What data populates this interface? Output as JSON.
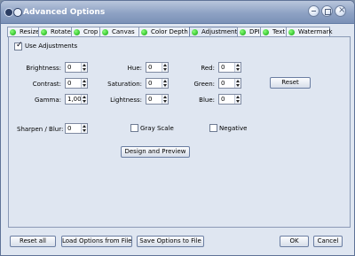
{
  "window": {
    "title": "Advanced Options"
  },
  "tabs": [
    {
      "label": "Resize"
    },
    {
      "label": "Rotate"
    },
    {
      "label": "Crop"
    },
    {
      "label": "Canvas"
    },
    {
      "label": "Color Depth"
    },
    {
      "label": "Adjustments"
    },
    {
      "label": "DPI"
    },
    {
      "label": "Text"
    },
    {
      "label": "Watermark"
    }
  ],
  "active_tab": "Adjustments",
  "use_adjustments": {
    "label": "Use Adjustments",
    "checked": true
  },
  "fields": {
    "brightness": {
      "label": "Brightness:",
      "value": "0"
    },
    "contrast": {
      "label": "Contrast:",
      "value": "0"
    },
    "gamma": {
      "label": "Gamma:",
      "value": "1,00"
    },
    "hue": {
      "label": "Hue:",
      "value": "0"
    },
    "saturation": {
      "label": "Saturation:",
      "value": "0"
    },
    "lightness": {
      "label": "Lightness:",
      "value": "0"
    },
    "red": {
      "label": "Red:",
      "value": "0"
    },
    "green": {
      "label": "Green:",
      "value": "0"
    },
    "blue": {
      "label": "Blue:",
      "value": "0"
    },
    "sharpen": {
      "label": "Sharpen / Blur:",
      "value": "0"
    }
  },
  "gray_scale": {
    "label": "Gray Scale",
    "checked": false
  },
  "negative": {
    "label": "Negative",
    "checked": false
  },
  "buttons": {
    "reset": "Reset",
    "design_preview": "Design and Preview",
    "reset_all": "Reset all",
    "load_options": "Load Options from File",
    "save_options": "Save Options to File",
    "ok": "OK",
    "cancel": "Cancel"
  },
  "colors": {
    "title_bar": "#8ea2c4",
    "panel": "#dfe6f1",
    "tab_dot": "#0aa40a"
  }
}
